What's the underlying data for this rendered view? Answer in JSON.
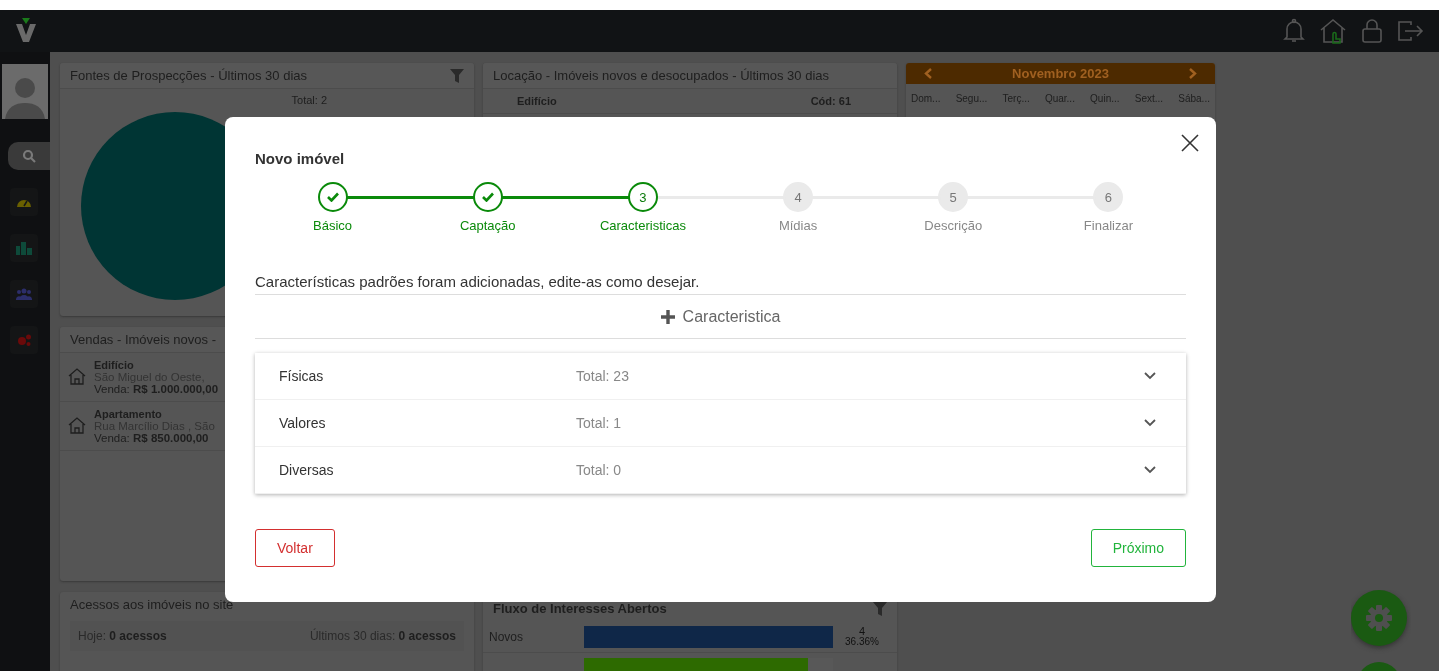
{
  "dashboard": {
    "prospection": {
      "title": "Fontes de Prospecções - Últimos 30 dias",
      "total": "Total: 2"
    },
    "rentals": {
      "title": "Locação - Imóveis novos e desocupados - Últimos 30 dias",
      "items": [
        {
          "type": "Edifício",
          "code": "Cód: 61"
        }
      ]
    },
    "calendar": {
      "month": "Novembro 2023",
      "weekdays": [
        "Dom...",
        "Segu...",
        "Terç...",
        "Quar...",
        "Quin...",
        "Sext...",
        "Sába..."
      ]
    },
    "sales": {
      "title": "Vendas - Imóveis novos -",
      "items": [
        {
          "type": "Edifício",
          "address": "São Miguel do Oeste,",
          "price": "Venda: **R$  1.000.000,00**"
        },
        {
          "type": "Apartamento",
          "address": "Rua Marcílio Dias , São",
          "price": "Venda: **R$  850.000,00**"
        }
      ]
    },
    "site_access": {
      "title": "Acessos aos imóveis no site",
      "today_label": "Hoje:",
      "today": "0 acessos",
      "month_label": "Últimos 30 dias:",
      "month": "0 acessos"
    },
    "interest_flow": {
      "title": "Fluxo de Interesses Abertos",
      "rows": [
        {
          "label": "Novos",
          "count": "4",
          "percent": "36.36%",
          "level": 1,
          "color": "#0f2748"
        },
        {
          "level": 0.9,
          "color": "#2d6a00"
        }
      ]
    }
  },
  "modal": {
    "title": "Novo imóvel",
    "steps": [
      {
        "label": "Básico",
        "done": true,
        "selected": false
      },
      {
        "label": "Captação",
        "done": true,
        "selected": false
      },
      {
        "number": "3",
        "label": "Caracteristicas",
        "done": false,
        "selected": true
      },
      {
        "number": "4",
        "label": "Mídias",
        "done": false,
        "selected": false
      },
      {
        "number": "5",
        "label": "Descrição",
        "done": false,
        "selected": false
      },
      {
        "number": "6",
        "label": "Finalizar",
        "done": false,
        "selected": false
      }
    ],
    "intro": "Características padrões foram adicionadas, edite-as como desejar.",
    "add_button": "Caracteristica",
    "groups": [
      {
        "name": "Físicas",
        "total": "Total: 23",
        "expanded": false
      },
      {
        "name": "Valores",
        "total": "Total: 1",
        "expanded": false
      },
      {
        "name": "Diversas",
        "total": "Total: 0",
        "expanded": false
      }
    ],
    "back_button": "Voltar",
    "next_button": "Próximo"
  }
}
